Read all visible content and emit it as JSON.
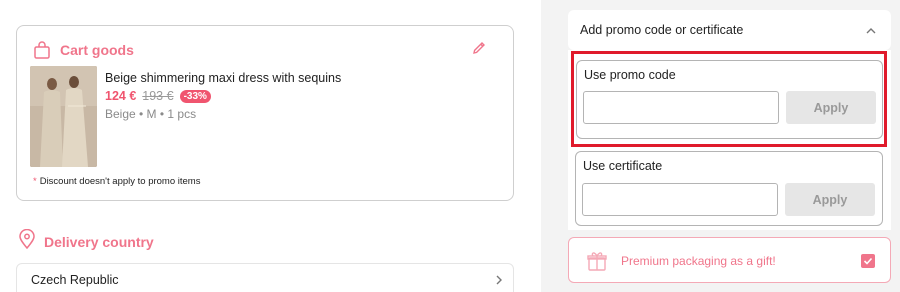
{
  "cart": {
    "title": "Cart goods",
    "product": {
      "name": "Beige shimmering maxi dress with sequins",
      "price": "124 €",
      "old_price": "193 €",
      "discount": "-33%",
      "variant": "Beige • M • 1 pcs"
    },
    "note_asterisk": "*",
    "note": "Discount doesn't apply to promo items"
  },
  "delivery": {
    "title": "Delivery country",
    "country": "Czech Republic"
  },
  "promo_panel": {
    "toggle_label": "Add promo code or certificate",
    "promo_label": "Use promo code",
    "promo_value": "",
    "promo_apply": "Apply",
    "cert_label": "Use certificate",
    "cert_value": "",
    "cert_apply": "Apply",
    "premium_label": "Premium packaging as a gift!",
    "premium_checked": true
  },
  "colors": {
    "accent": "#f0758b",
    "highlight": "#e01a2b",
    "sale": "#f0556f"
  },
  "icons": {
    "cart": "shopping-bag-icon",
    "edit": "pencil-icon",
    "location": "map-pin-icon",
    "chevron_right": "chevron-right-icon",
    "chevron_up": "chevron-up-icon",
    "gift": "gift-icon",
    "check": "check-icon"
  }
}
